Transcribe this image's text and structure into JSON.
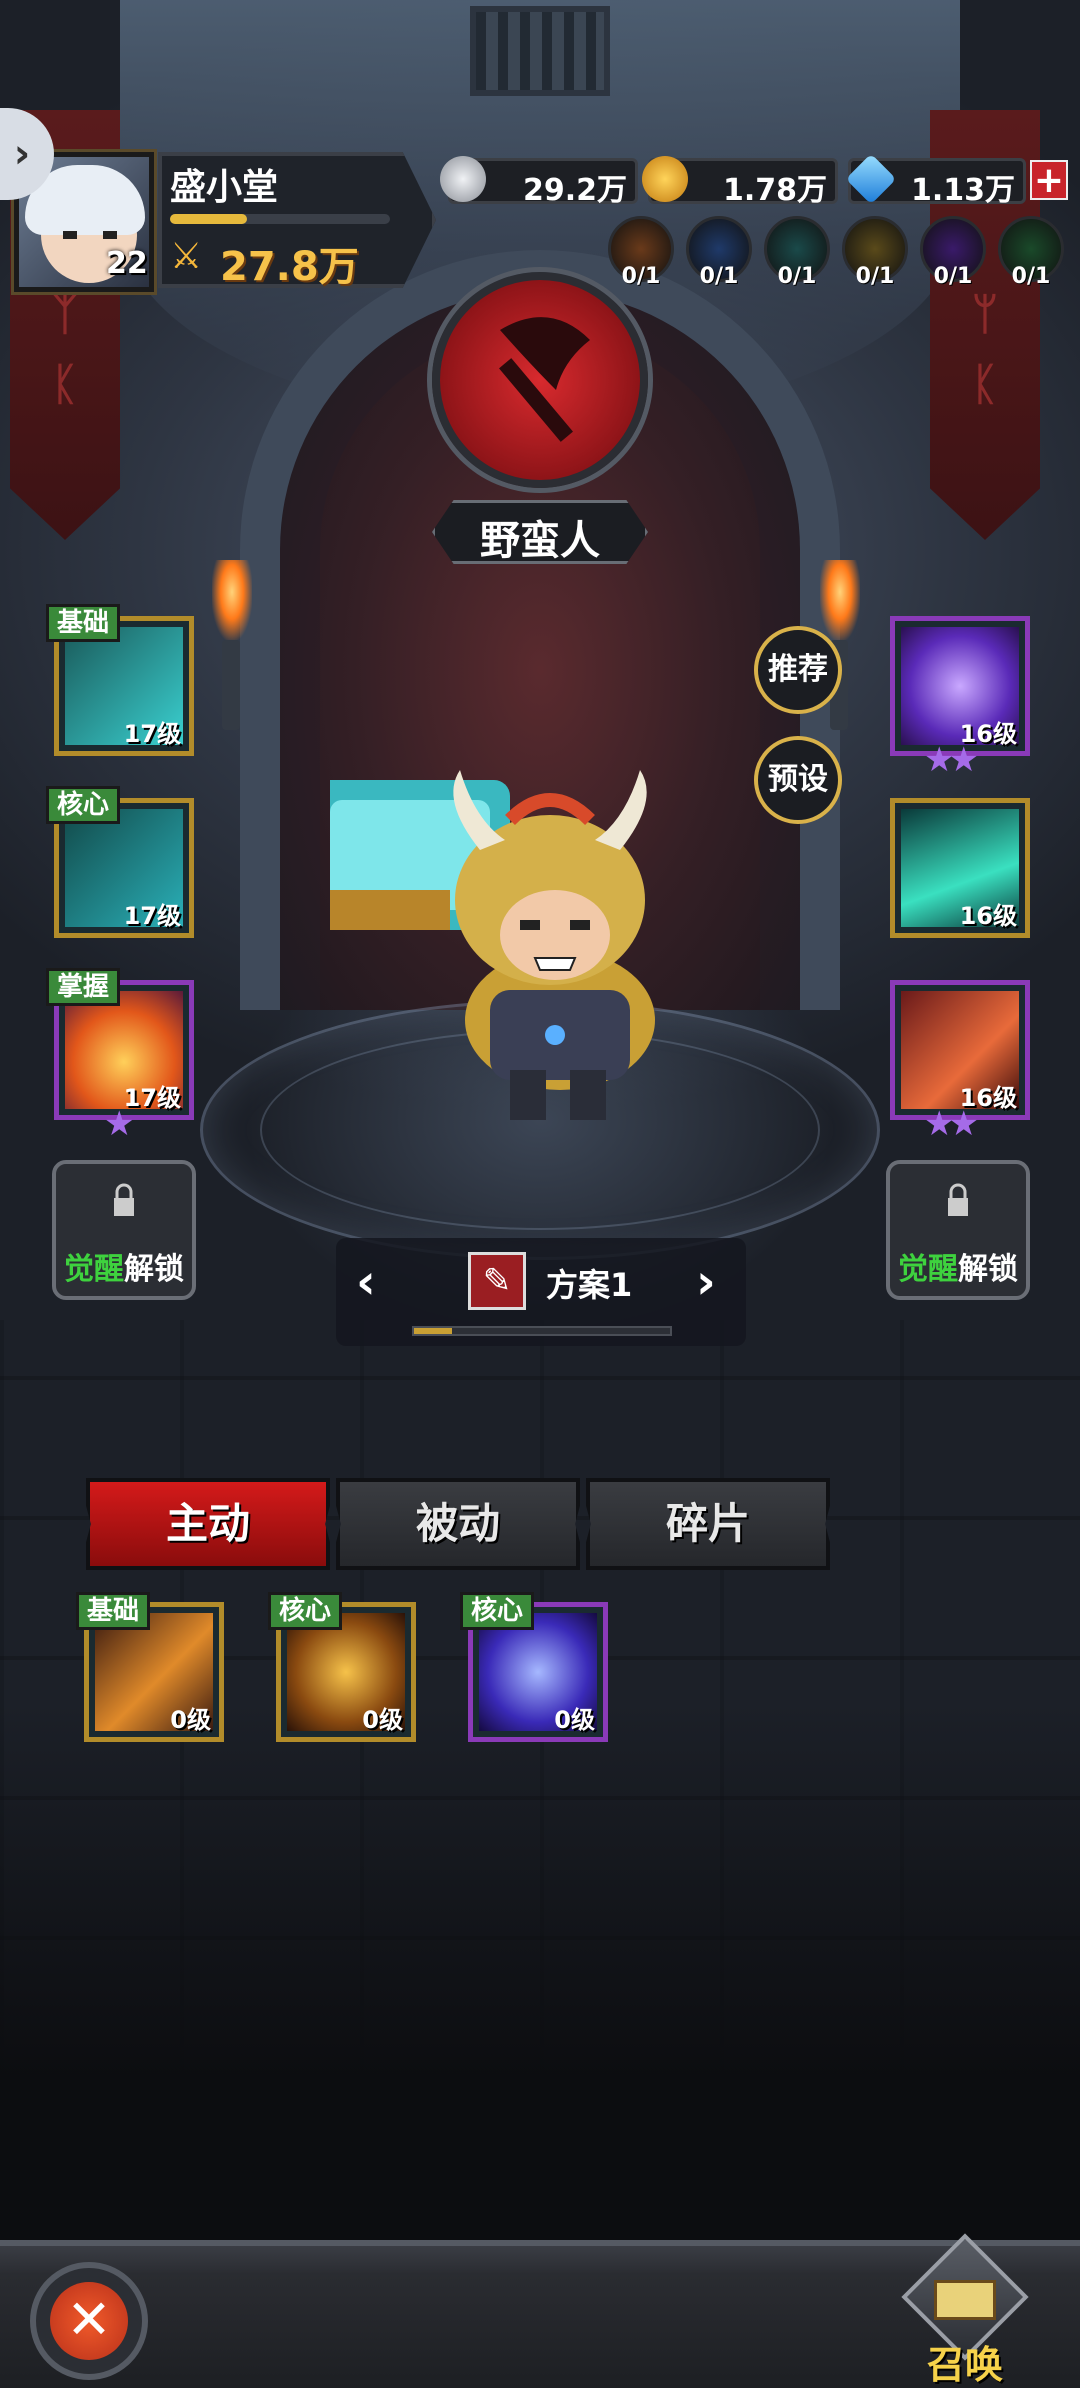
{
  "player": {
    "name": "盛小堂",
    "level": "22",
    "power": "27.8万",
    "exp_fraction": 0.35
  },
  "currencies": [
    {
      "icon": "silver-coin-icon",
      "value": "29.2万",
      "color": "#c9ccd2"
    },
    {
      "icon": "gold-coin-icon",
      "value": "1.78万",
      "color": "#f0a81a"
    },
    {
      "icon": "diamond-icon",
      "value": "1.13万",
      "color": "#3aa8f5"
    }
  ],
  "elements": [
    {
      "icon": "fire-element-icon",
      "count": "0/1",
      "color": "#6a3a1a"
    },
    {
      "icon": "water-element-icon",
      "count": "0/1",
      "color": "#1f3a6a"
    },
    {
      "icon": "wind-element-icon",
      "count": "0/1",
      "color": "#1a4a4a"
    },
    {
      "icon": "earth-element-icon",
      "count": "0/1",
      "color": "#5a4a1a"
    },
    {
      "icon": "dark-element-icon",
      "count": "0/1",
      "color": "#3a1a6a"
    },
    {
      "icon": "nature-element-icon",
      "count": "0/1",
      "color": "#1a4a2a"
    }
  ],
  "class_name": "野蛮人",
  "side_buttons": {
    "recommend": "推荐",
    "preset": "预设"
  },
  "left_skills": [
    {
      "tag": "基础",
      "level": "17级",
      "icon": "ice-claw-icon",
      "stars": ""
    },
    {
      "tag": "核心",
      "level": "17级",
      "icon": "ice-whirl-icon",
      "stars": ""
    },
    {
      "tag": "掌握",
      "level": "17级",
      "icon": "flame-icon",
      "stars": "★"
    }
  ],
  "right_skills": [
    {
      "level": "16级",
      "icon": "lightning-strike-icon",
      "stars": "★★"
    },
    {
      "level": "16级",
      "icon": "ice-shards-icon",
      "stars": ""
    },
    {
      "level": "16级",
      "icon": "sword-buff-icon",
      "stars": "★★"
    }
  ],
  "locked": {
    "awaken": "觉醒",
    "unlock": "解锁"
  },
  "preset": {
    "name": "方案1",
    "progress": 0.15
  },
  "tabs": [
    "主动",
    "被动",
    "碎片"
  ],
  "bottom_skills": [
    {
      "tag": "基础",
      "level": "0级",
      "icon": "axe-slash-icon"
    },
    {
      "tag": "核心",
      "level": "0级",
      "icon": "hammer-icon"
    },
    {
      "tag": "核心",
      "level": "0级",
      "icon": "lightning-hammer-icon"
    }
  ],
  "summon_label": "召唤"
}
